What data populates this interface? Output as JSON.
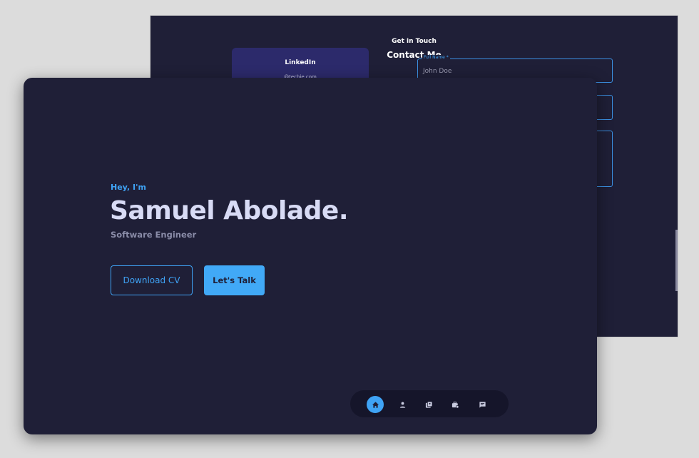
{
  "contact_page": {
    "kicker": "Get in Touch",
    "heading": "Contact Me",
    "card": {
      "title": "LinkedIn",
      "value": "@techie.com"
    },
    "form": {
      "name_label": "Full Name *",
      "name_value": "John Doe"
    }
  },
  "hero": {
    "greeting": "Hey, I'm",
    "name": "Samuel Abolade.",
    "role": "Software Engineer",
    "cta_secondary": "Download CV",
    "cta_primary": "Let's Talk"
  },
  "dock": {
    "items": [
      {
        "icon": "home-icon",
        "active": true
      },
      {
        "icon": "person-icon",
        "active": false
      },
      {
        "icon": "portfolio-icon",
        "active": false
      },
      {
        "icon": "services-icon",
        "active": false
      },
      {
        "icon": "message-icon",
        "active": false
      }
    ]
  },
  "colors": {
    "background": "#1f1f37",
    "accent": "#3fa3f5",
    "card": "#2c2a6b",
    "dock": "#15152a"
  }
}
